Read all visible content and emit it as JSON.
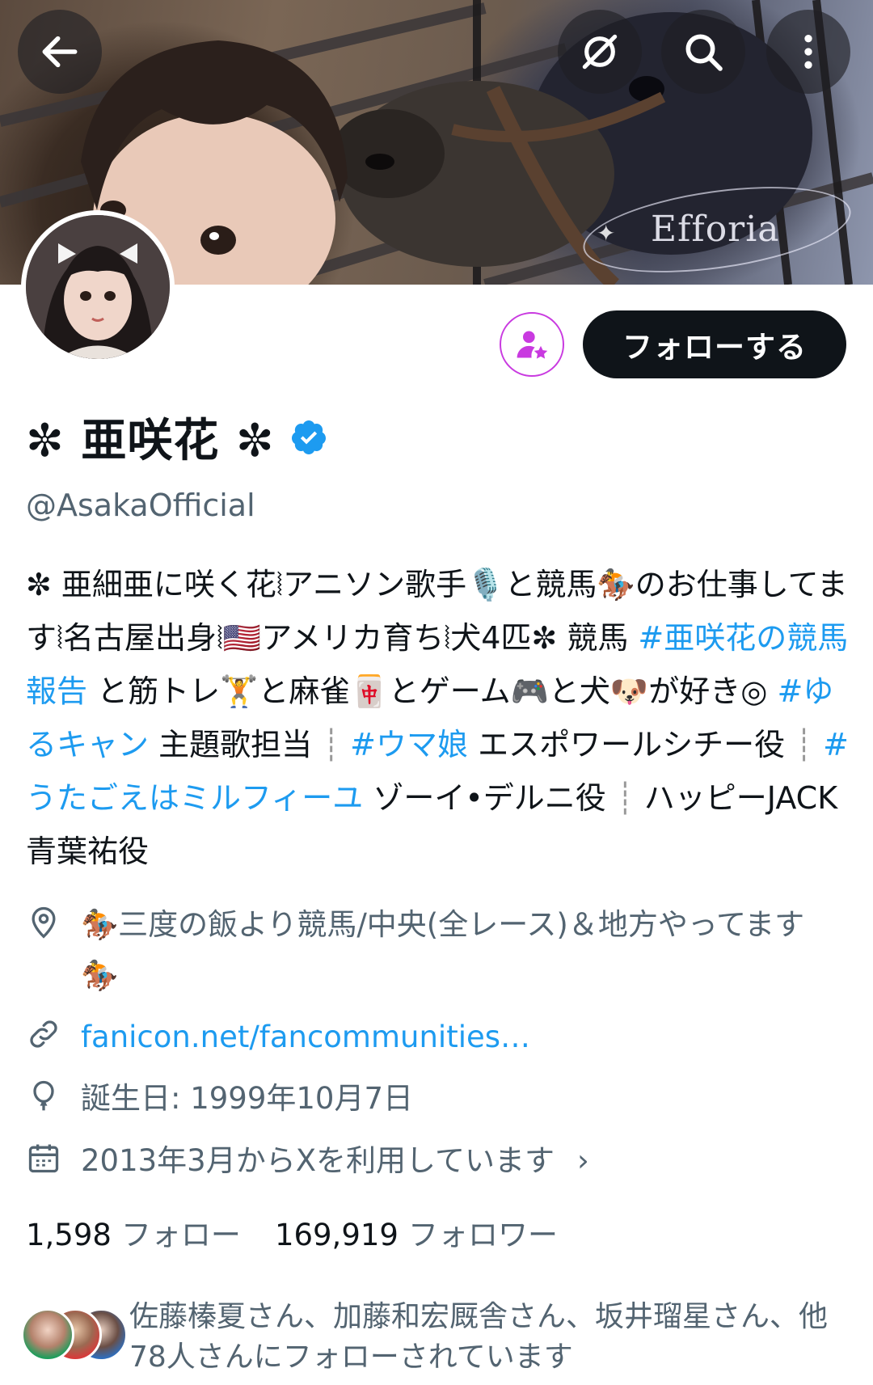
{
  "banner": {
    "watermark": "Efforia"
  },
  "actions": {
    "follow_label": "フォローする"
  },
  "profile": {
    "display_name": "✼ 亜咲花 ✼",
    "handle": "@AsakaOfficial",
    "verified": true
  },
  "bio": {
    "text_1": "✼ 亜細亜に咲く花⦚アニソン歌手🎙️と競馬🏇のお仕事してます⦚名古屋出身⦚🇺🇸アメリカ育ち⦚犬4匹✼ 競馬 ",
    "tag_1": "#亜咲花の競馬報告",
    "text_2": " と筋トレ🏋️と麻雀🀄️とゲーム🎮と犬🐶が好き◎ ",
    "tag_2": "#ゆるキャン",
    "text_3": " 主題歌担当 ",
    "pipe_1": "┊",
    "tag_3": " #ウマ娘",
    "text_4": " エスポワールシチー役 ",
    "pipe_2": "┊",
    "tag_4": " #うたごえはミルフィーユ",
    "text_5": " ゾーイ•デルニ役 ",
    "pipe_3": "┊",
    "text_6": " ハッピーJACK 青葉祐役"
  },
  "meta": {
    "location": "🏇三度の飯より競馬/中央(全レース)＆地方やってます🏇",
    "url": "fanicon.net/fancommunities…",
    "birthday": "誕生日: 1999年10月7日",
    "joined": "2013年3月からXを利用しています",
    "joined_chevron": "›"
  },
  "stats": {
    "following_count": "1,598",
    "following_label": "フォロー",
    "followers_count": "169,919",
    "followers_label": "フォロワー"
  },
  "followed_by": {
    "text": "佐藤榛夏さん、加藤和宏厩舎さん、坂井瑠星さん、他78人さんにフォローされています"
  },
  "colors": {
    "accent": "#1d9bf0",
    "secondary_text": "#536471",
    "primary_text": "#0f1419",
    "favorite_ring": "#c93ae0"
  },
  "icons": [
    "back-arrow-icon",
    "grok-icon",
    "search-icon",
    "more-vertical-icon",
    "favorite-user-icon",
    "verified-badge-icon",
    "location-pin-icon",
    "link-icon",
    "balloon-icon",
    "calendar-icon",
    "chevron-right-icon"
  ]
}
